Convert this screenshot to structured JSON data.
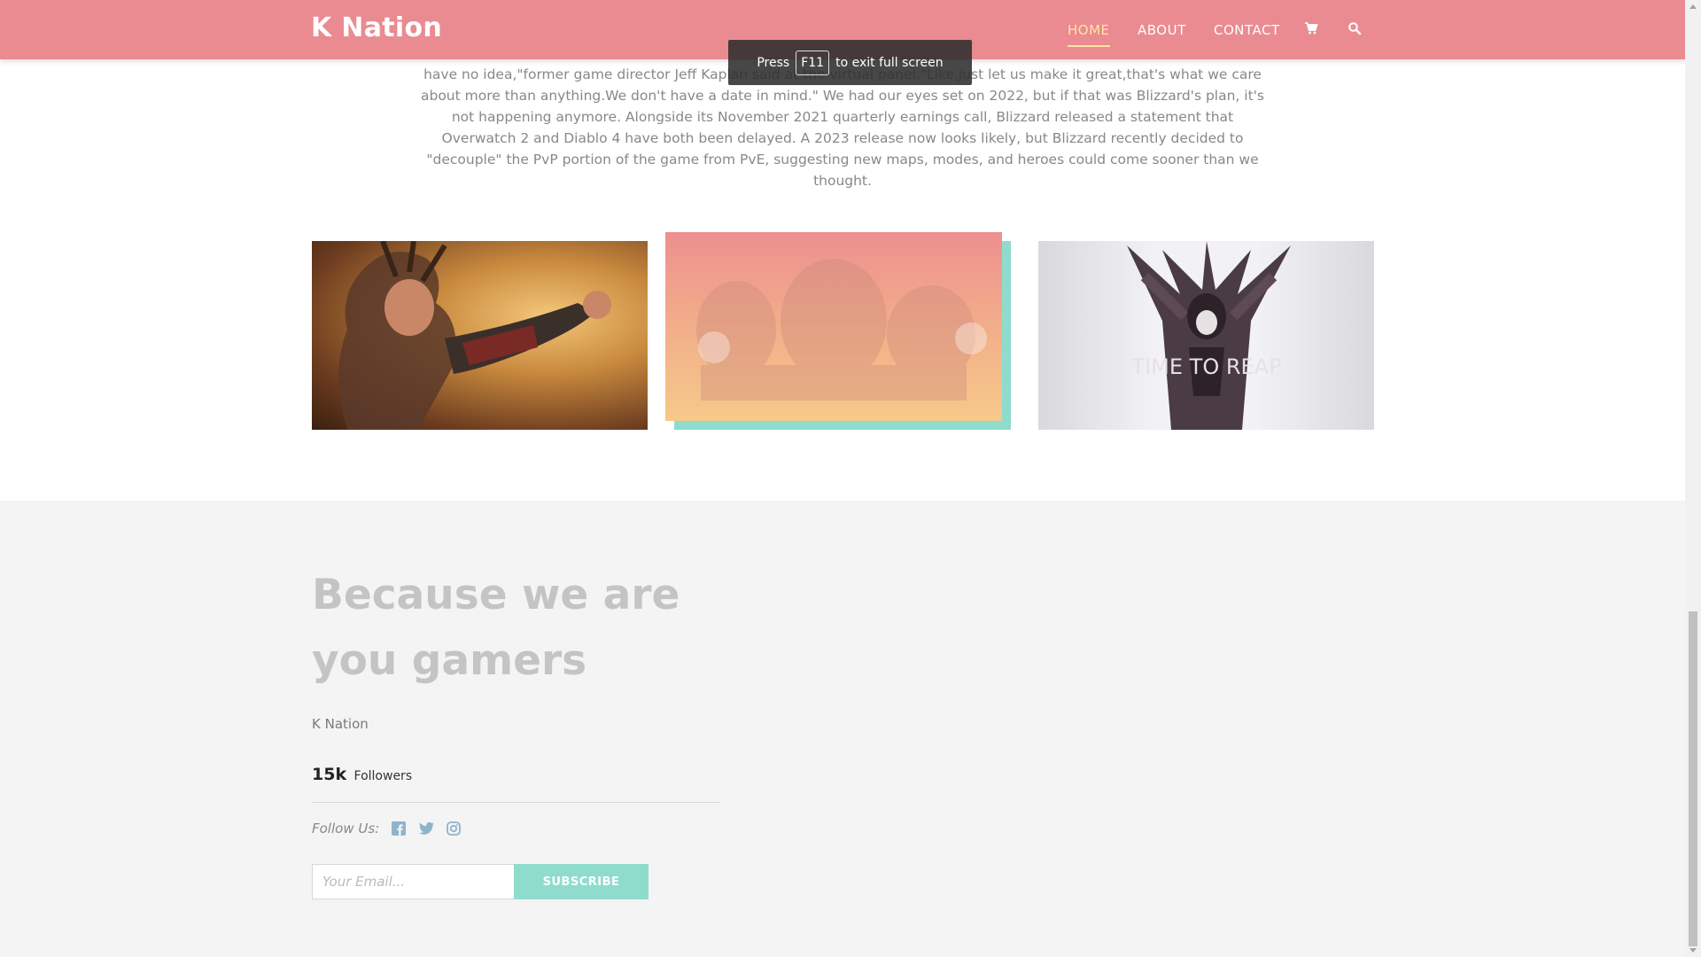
{
  "header": {
    "brand": "K Nation",
    "nav": [
      {
        "label": "HOME",
        "active": true
      },
      {
        "label": "ABOUT",
        "active": false
      },
      {
        "label": "CONTACT",
        "active": false
      }
    ],
    "icons": [
      "cart-icon",
      "search-icon"
    ],
    "background": "#ea8a91",
    "active_color": "#fde6a5"
  },
  "toast": {
    "prefix": "Press",
    "key": "F11",
    "suffix": "to exit full screen"
  },
  "article": {
    "text": "have no idea,\"former game director Jeff Kaplan said at the virtual panel.\"Like,just let us make it great,that's what we care about more than anything.We don't have a date in mind.\" We had our eyes set on 2022, but if that was Blizzard's plan, it's not happening anymore. Alongside its November 2021 quarterly earnings call, Blizzard released a statement that Overwatch 2 and Diablo 4 have both been delayed. A 2023 release now looks likely, but Blizzard recently decided to \"decouple\" the PvP portion of the game from PvE, suggesting new maps, modes, and heroes could come sooner than we thought."
  },
  "gallery": {
    "image3_caption": "TIME TO REAP",
    "accent": "#8fdccd"
  },
  "footer": {
    "tagline": "Because we are you gamers",
    "brand": "K Nation",
    "followers_count": "15k",
    "followers_label": "Followers",
    "follow_label": "Follow Us:",
    "social": [
      "facebook-icon",
      "twitter-icon",
      "instagram-icon"
    ],
    "email_placeholder": "Your Email...",
    "subscribe_label": "SUBSCRIBE"
  }
}
